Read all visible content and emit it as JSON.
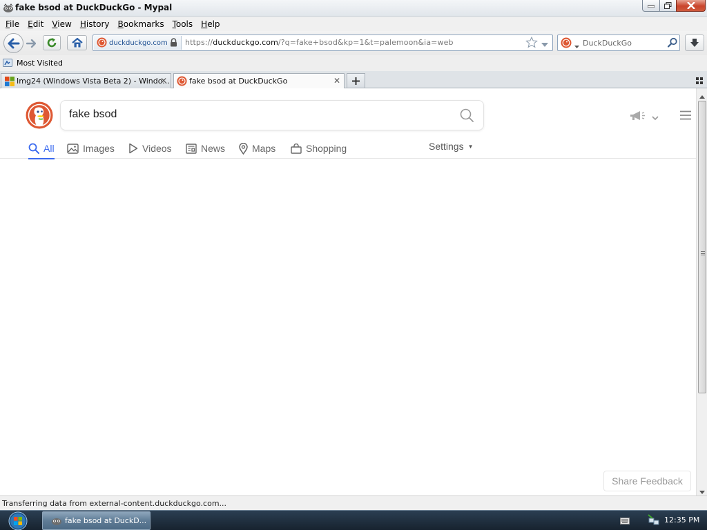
{
  "window": {
    "title": "fake bsod at DuckDuckGo - Mypal"
  },
  "menubar": {
    "items": [
      {
        "label": "File",
        "key": "F",
        "rest": "ile"
      },
      {
        "label": "Edit",
        "key": "E",
        "rest": "dit"
      },
      {
        "label": "View",
        "key": "V",
        "rest": "iew"
      },
      {
        "label": "History",
        "key": "H",
        "rest": "istory"
      },
      {
        "label": "Bookmarks",
        "key": "B",
        "rest": "ookmarks"
      },
      {
        "label": "Tools",
        "key": "T",
        "rest": "ools"
      },
      {
        "label": "Help",
        "key": "H",
        "rest": "elp"
      }
    ]
  },
  "navbar": {
    "identity_domain": "duckduckgo.com",
    "url_scheme": "https://",
    "url_host": "duckduckgo.com",
    "url_path": "/?q=fake+bsod&kp=1&t=palemoon&ia=web",
    "search_engine_placeholder": "DuckDuckGo"
  },
  "bookmarks": {
    "most_visited": "Most Visited"
  },
  "tabs": [
    {
      "label": "Img24 (Windows Vista Beta 2) - Windo...",
      "active": false
    },
    {
      "label": "fake bsod at DuckDuckGo",
      "active": true
    }
  ],
  "page": {
    "query": "fake bsod",
    "nav_tabs": {
      "all": "All",
      "images": "Images",
      "videos": "Videos",
      "news": "News",
      "maps": "Maps",
      "shopping": "Shopping"
    },
    "settings": "Settings",
    "share_feedback": "Share Feedback"
  },
  "statusbar": {
    "text": "Transferring data from external-content.duckduckgo.com..."
  },
  "taskbar": {
    "task_label": "fake bsod at DuckD...",
    "clock": "12:35 PM"
  },
  "colors": {
    "ddg_orange": "#de5833",
    "ddg_blue": "#3969ef",
    "close_red": "#c9452c"
  }
}
